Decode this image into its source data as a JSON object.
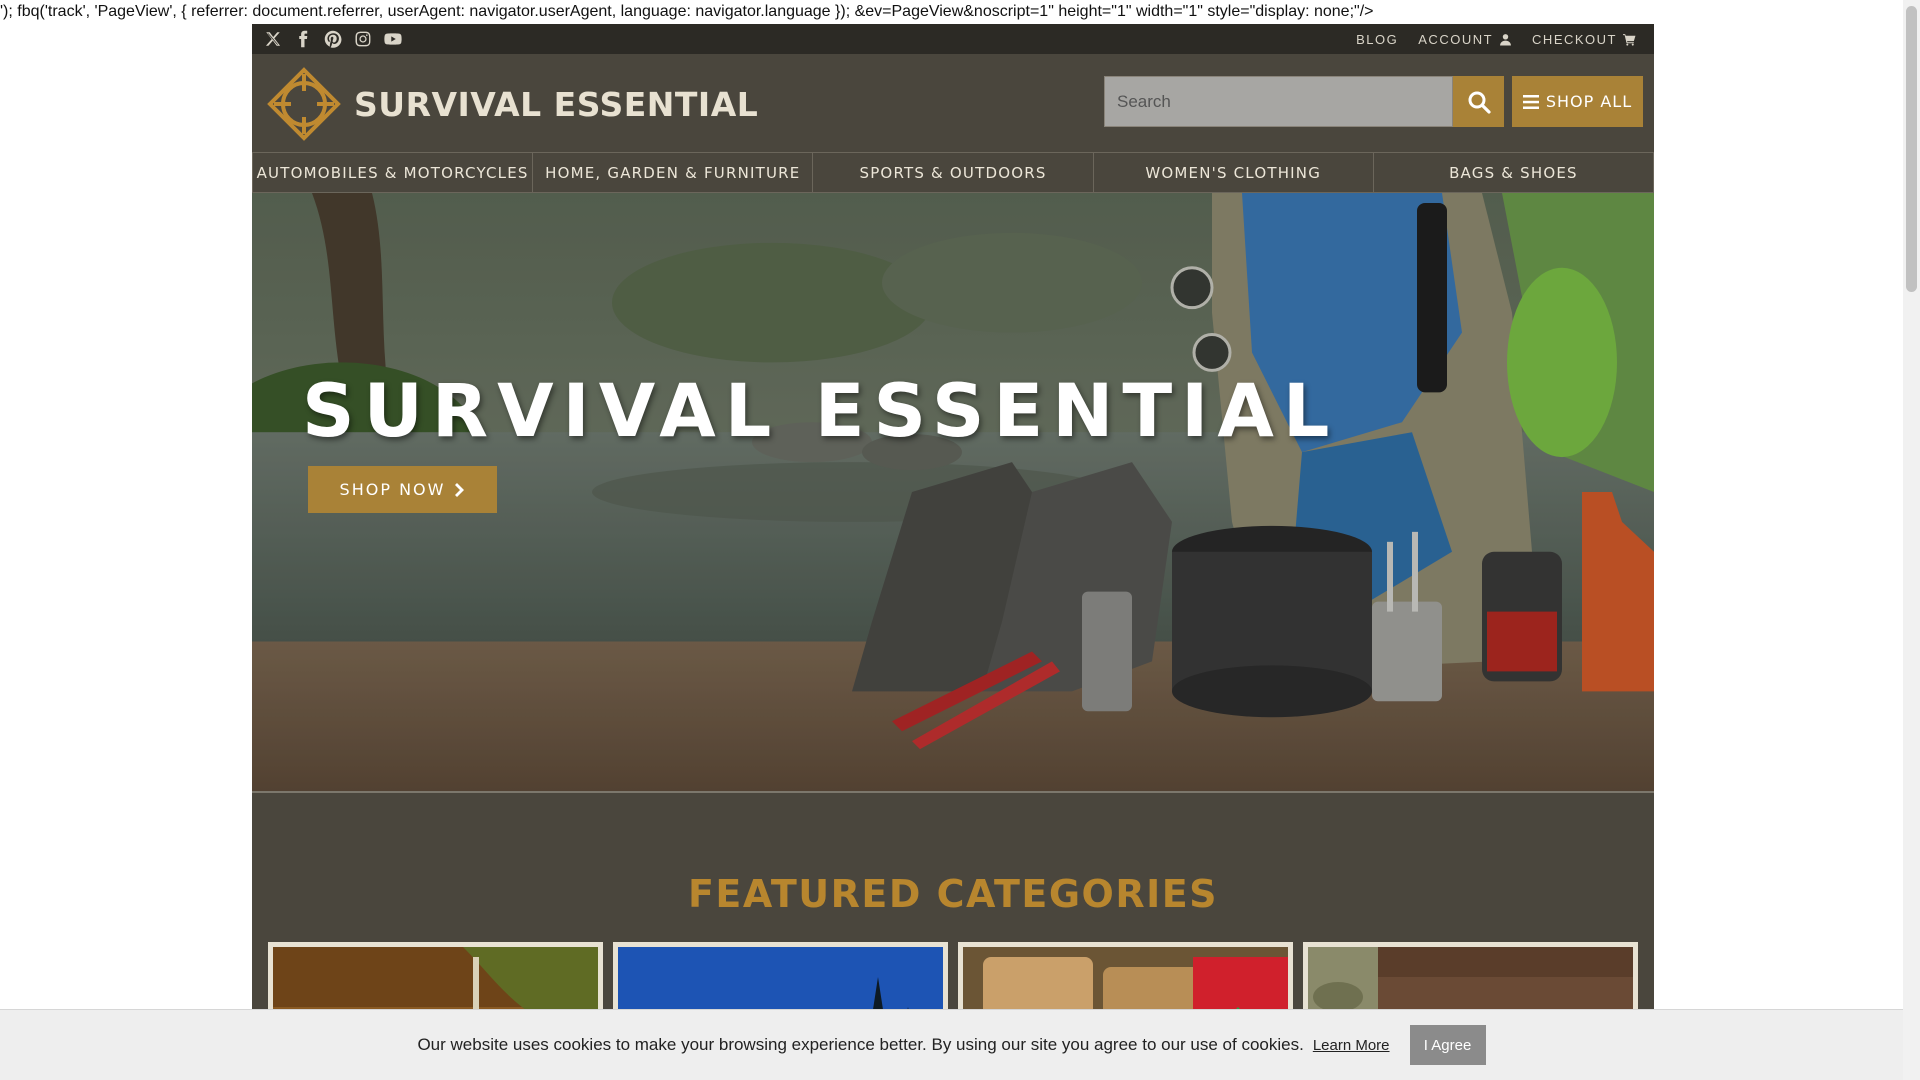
{
  "page_leak": {
    "text": "'); fbq('track', 'PageView', { referrer: document.referrer, userAgent: navigator.userAgent, language: navigator.language }); &ev=PageView&noscript=1\" height=\"1\" width=\"1\" style=\"display: none;\"/>"
  },
  "topbar": {
    "socials": [
      "x-icon",
      "facebook-icon",
      "pinterest-icon",
      "instagram-icon",
      "youtube-icon"
    ],
    "blog": "BLOG",
    "account": "ACCOUNT",
    "checkout": "CHECKOUT"
  },
  "header": {
    "brand": "SURVIVAL ESSENTIAL",
    "search_placeholder": "Search",
    "shop_all": "SHOP ALL"
  },
  "nav": {
    "items": [
      "AUTOMOBILES & MOTORCYCLES",
      "HOME, GARDEN & FURNITURE",
      "SPORTS & OUTDOORS",
      "WOMEN'S CLOTHING",
      "BAGS & SHOES"
    ]
  },
  "hero": {
    "title": "SURVIVAL ESSENTIAL",
    "cta": "SHOP NOW"
  },
  "featured": {
    "title": "FEATURED CATEGORIES"
  },
  "cookie": {
    "message": "Our website uses cookies to make your browsing experience better. By using our site you agree to our use of cookies.",
    "learn_more": "Learn More",
    "agree": "I Agree"
  },
  "colors": {
    "accent": "#a98237",
    "header_bg": "#4a463d",
    "topbar_bg": "#2c2a25",
    "featured_title": "#b8862e"
  }
}
